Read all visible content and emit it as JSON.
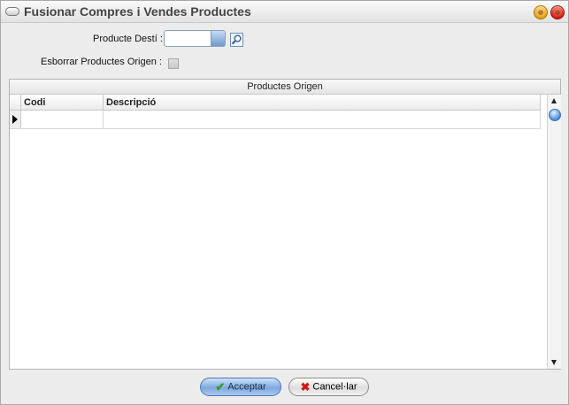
{
  "window": {
    "title": "Fusionar Compres i Vendes Productes"
  },
  "form": {
    "dest_label": "Producte Destí :",
    "dest_value": "",
    "delete_label": "Esborrar Productes Origen :",
    "delete_checked": false
  },
  "grid": {
    "title": "Productes Origen",
    "columns": [
      "Codi",
      "Descripció"
    ],
    "rows": [
      {
        "codi": "",
        "descripcio": ""
      }
    ]
  },
  "buttons": {
    "accept": "Acceptar",
    "cancel": "Cancel·lar"
  },
  "icons": {
    "accept": "check-icon",
    "cancel": "x-icon",
    "lookup": "magnifier-icon"
  },
  "colors": {
    "accent": "#7ea9de",
    "accept_check": "#2f9a1c",
    "cancel_x": "#d21a10"
  }
}
